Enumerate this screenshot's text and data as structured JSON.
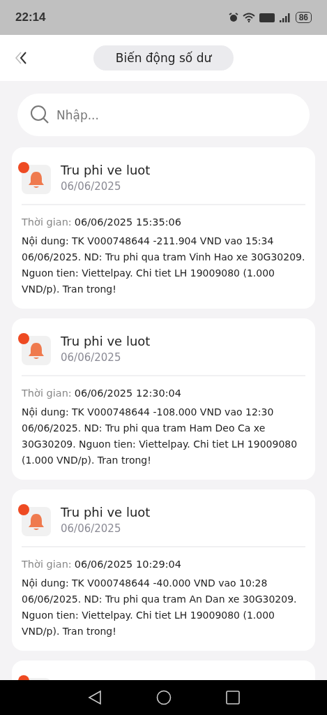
{
  "status_bar": {
    "time": "22:14",
    "battery": "86"
  },
  "header": {
    "title": "Biến động số dư"
  },
  "search": {
    "placeholder": "Nhập..."
  },
  "notifications": [
    {
      "unread": true,
      "title": "Tru phi ve luot",
      "date": "06/06/2025",
      "time_label": "Thời gian:",
      "time": "06/06/2025 15:35:06",
      "content": "Nội dung: TK V000748644 -211.904 VND vao 15:34 06/06/2025. ND: Tru phi qua tram Vinh Hao xe 30G30209. Nguon tien: Viettelpay. Chi tiet LH 19009080 (1.000 VND/p). Tran trong!"
    },
    {
      "unread": true,
      "title": "Tru phi ve luot",
      "date": "06/06/2025",
      "time_label": "Thời gian:",
      "time": "06/06/2025 12:30:04",
      "content": "Nội dung: TK V000748644 -108.000 VND vao 12:30 06/06/2025. ND: Tru phi qua tram Ham Deo Ca xe 30G30209. Nguon tien: Viettelpay. Chi tiet LH 19009080 (1.000 VND/p). Tran trong!"
    },
    {
      "unread": true,
      "title": "Tru phi ve luot",
      "date": "06/06/2025",
      "time_label": "Thời gian:",
      "time": "06/06/2025 10:29:04",
      "content": "Nội dung: TK V000748644 -40.000 VND vao 10:28 06/06/2025. ND: Tru phi qua tram An Dan xe 30G30209. Nguon tien: Viettelpay. Chi tiet LH 19009080 (1.000 VND/p). Tran trong!"
    },
    {
      "unread": true
    }
  ]
}
